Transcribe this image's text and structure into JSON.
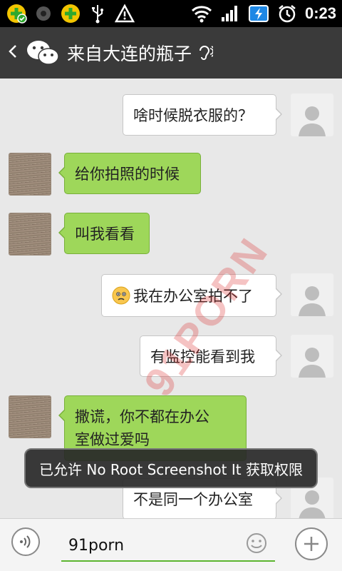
{
  "status_bar": {
    "time": "0:23",
    "left_icons": [
      "360-security-icon",
      "circle-dot-icon",
      "360-plus-icon",
      "usb-icon",
      "warning-icon"
    ],
    "right_icons": [
      "wifi-icon",
      "signal-icon",
      "battery-charging-icon",
      "alarm-icon"
    ]
  },
  "header": {
    "back_icon": "chevron-left-icon",
    "logo_icon": "wechat-icon",
    "title": "来自大连的瓶子",
    "voice_mode_icon": "ear-icon"
  },
  "messages": [
    {
      "side": "right",
      "text": "啥时候脱衣服的？"
    },
    {
      "side": "left",
      "text": "给你拍照的时候"
    },
    {
      "side": "left",
      "text": "叫我看看"
    },
    {
      "side": "right",
      "text": "我在办公室拍不了",
      "emoji": "sad-face-icon"
    },
    {
      "side": "right",
      "text": "有监控能看到我"
    },
    {
      "side": "left",
      "text_line1": "撒谎，你不都在办公",
      "text_line2": "室做过爱吗"
    },
    {
      "side": "right",
      "text": "不是同一个办公室"
    }
  ],
  "toast": {
    "text": "已允许 No Root Screenshot It 获取权限"
  },
  "watermark": {
    "text": "91PORN"
  },
  "input_bar": {
    "voice_icon": "voice-wave-icon",
    "input_value": "91porn",
    "emoji_icon": "smiley-icon",
    "plus_icon": "plus-icon"
  },
  "colors": {
    "statusbar": "#000000",
    "titlebar": "#3a3a3a",
    "chat_bg": "#e8e8e8",
    "bubble_left": "#9ed75a",
    "bubble_right": "#ffffff",
    "input_underline": "#5cb530"
  }
}
